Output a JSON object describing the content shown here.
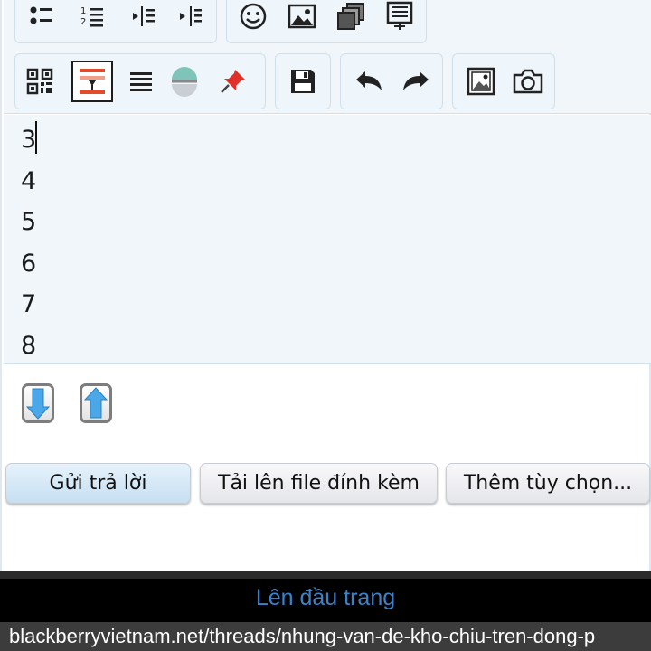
{
  "toolbar": {
    "row1": [
      "bullet-list-icon",
      "numbered-list-icon",
      "outdent-icon",
      "indent-icon",
      "smiley-icon",
      "image-icon",
      "media-icon",
      "template-icon"
    ],
    "row2": [
      "qr-code-icon",
      "format-highlight-icon",
      "justify-icon",
      "horizontal-rule-icon",
      "pin-icon",
      "save-icon",
      "undo-icon",
      "redo-icon",
      "insert-picture-icon",
      "camera-icon"
    ]
  },
  "editor": {
    "lines": [
      "3",
      "4",
      "5",
      "6",
      "7",
      "8"
    ]
  },
  "actions": {
    "reply_label": "Gửi trả lời",
    "upload_label": "Tải lên file đính kèm",
    "more_label": "Thêm tùy chọn..."
  },
  "footer": {
    "top_link": "Lên đầu trang"
  },
  "browser": {
    "url": "blackberryvietnam.net/threads/nhung-van-de-kho-chiu-tren-dong-p"
  },
  "colors": {
    "primary_button": "#c6dff2",
    "link": "#3a82c9",
    "editor_bg": "#f1f6fb"
  }
}
